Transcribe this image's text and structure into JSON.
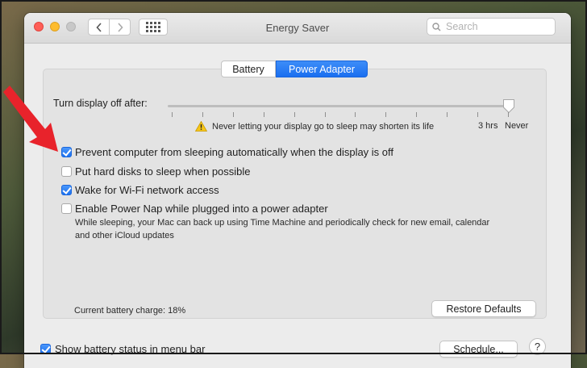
{
  "window": {
    "title": "Energy Saver"
  },
  "toolbar": {
    "back_icon": "chevron-left-icon",
    "forward_icon": "chevron-right-icon",
    "grid_icon": "grid-icon"
  },
  "search": {
    "placeholder": "Search"
  },
  "tabs": [
    {
      "label": "Battery",
      "active": false
    },
    {
      "label": "Power Adapter",
      "active": true
    }
  ],
  "display": {
    "label": "Turn display off after:",
    "slider_value": "Never",
    "warning": "Never letting your display go to sleep may shorten its life",
    "tick_3hrs": "3 hrs",
    "tick_never": "Never"
  },
  "options": [
    {
      "label": "Prevent computer from sleeping automatically when the display is off",
      "checked": true
    },
    {
      "label": "Put hard disks to sleep when possible",
      "checked": false
    },
    {
      "label": "Wake for Wi-Fi network access",
      "checked": true
    },
    {
      "label": "Enable Power Nap while plugged into a power adapter",
      "checked": false
    }
  ],
  "power_nap_description": "While sleeping, your Mac can back up using Time Machine and periodically check for new email, calendar and other iCloud updates",
  "battery_charge": "Current battery charge: 18%",
  "restore_label": "Restore Defaults",
  "show_battery_label": "Show battery status in menu bar",
  "show_battery_checked": true,
  "schedule_label": "Schedule...",
  "help_label": "?",
  "colors": {
    "accent": "#1a6ff0",
    "arrow": "#e8232b"
  }
}
